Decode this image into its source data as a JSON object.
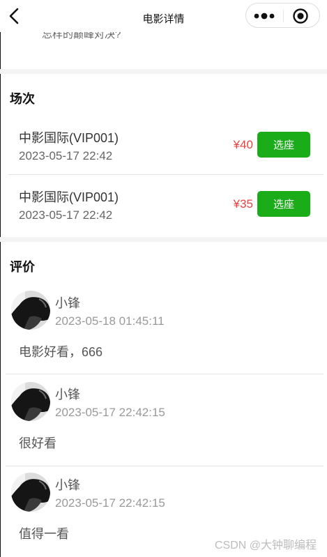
{
  "nav": {
    "title": "电影详情",
    "back_icon": "chevron-left-icon",
    "more_icon": "more-dots-icon",
    "close_icon": "target-icon"
  },
  "description_cut": "忘样的巅峰对决?",
  "sessions_section": {
    "title": "场次",
    "select_label": "选座",
    "items": [
      {
        "cinema": "中影国际(VIP001)",
        "time": "2023-05-17 22:42",
        "price": "¥40"
      },
      {
        "cinema": "中影国际(VIP001)",
        "time": "2023-05-17 22:42",
        "price": "¥35"
      }
    ]
  },
  "comments_section": {
    "title": "评价",
    "items": [
      {
        "user": "小锋",
        "time": "2023-05-18 01:45:11",
        "text": "电影好看，666"
      },
      {
        "user": "小锋",
        "time": "2023-05-17 22:42:15",
        "text": "很好看"
      },
      {
        "user": "小锋",
        "time": "2023-05-17 22:42:15",
        "text": "值得一看"
      }
    ]
  },
  "watermark": "CSDN @大钟聊编程",
  "colors": {
    "accent_green": "#1aad19",
    "price_red": "#e54340"
  }
}
